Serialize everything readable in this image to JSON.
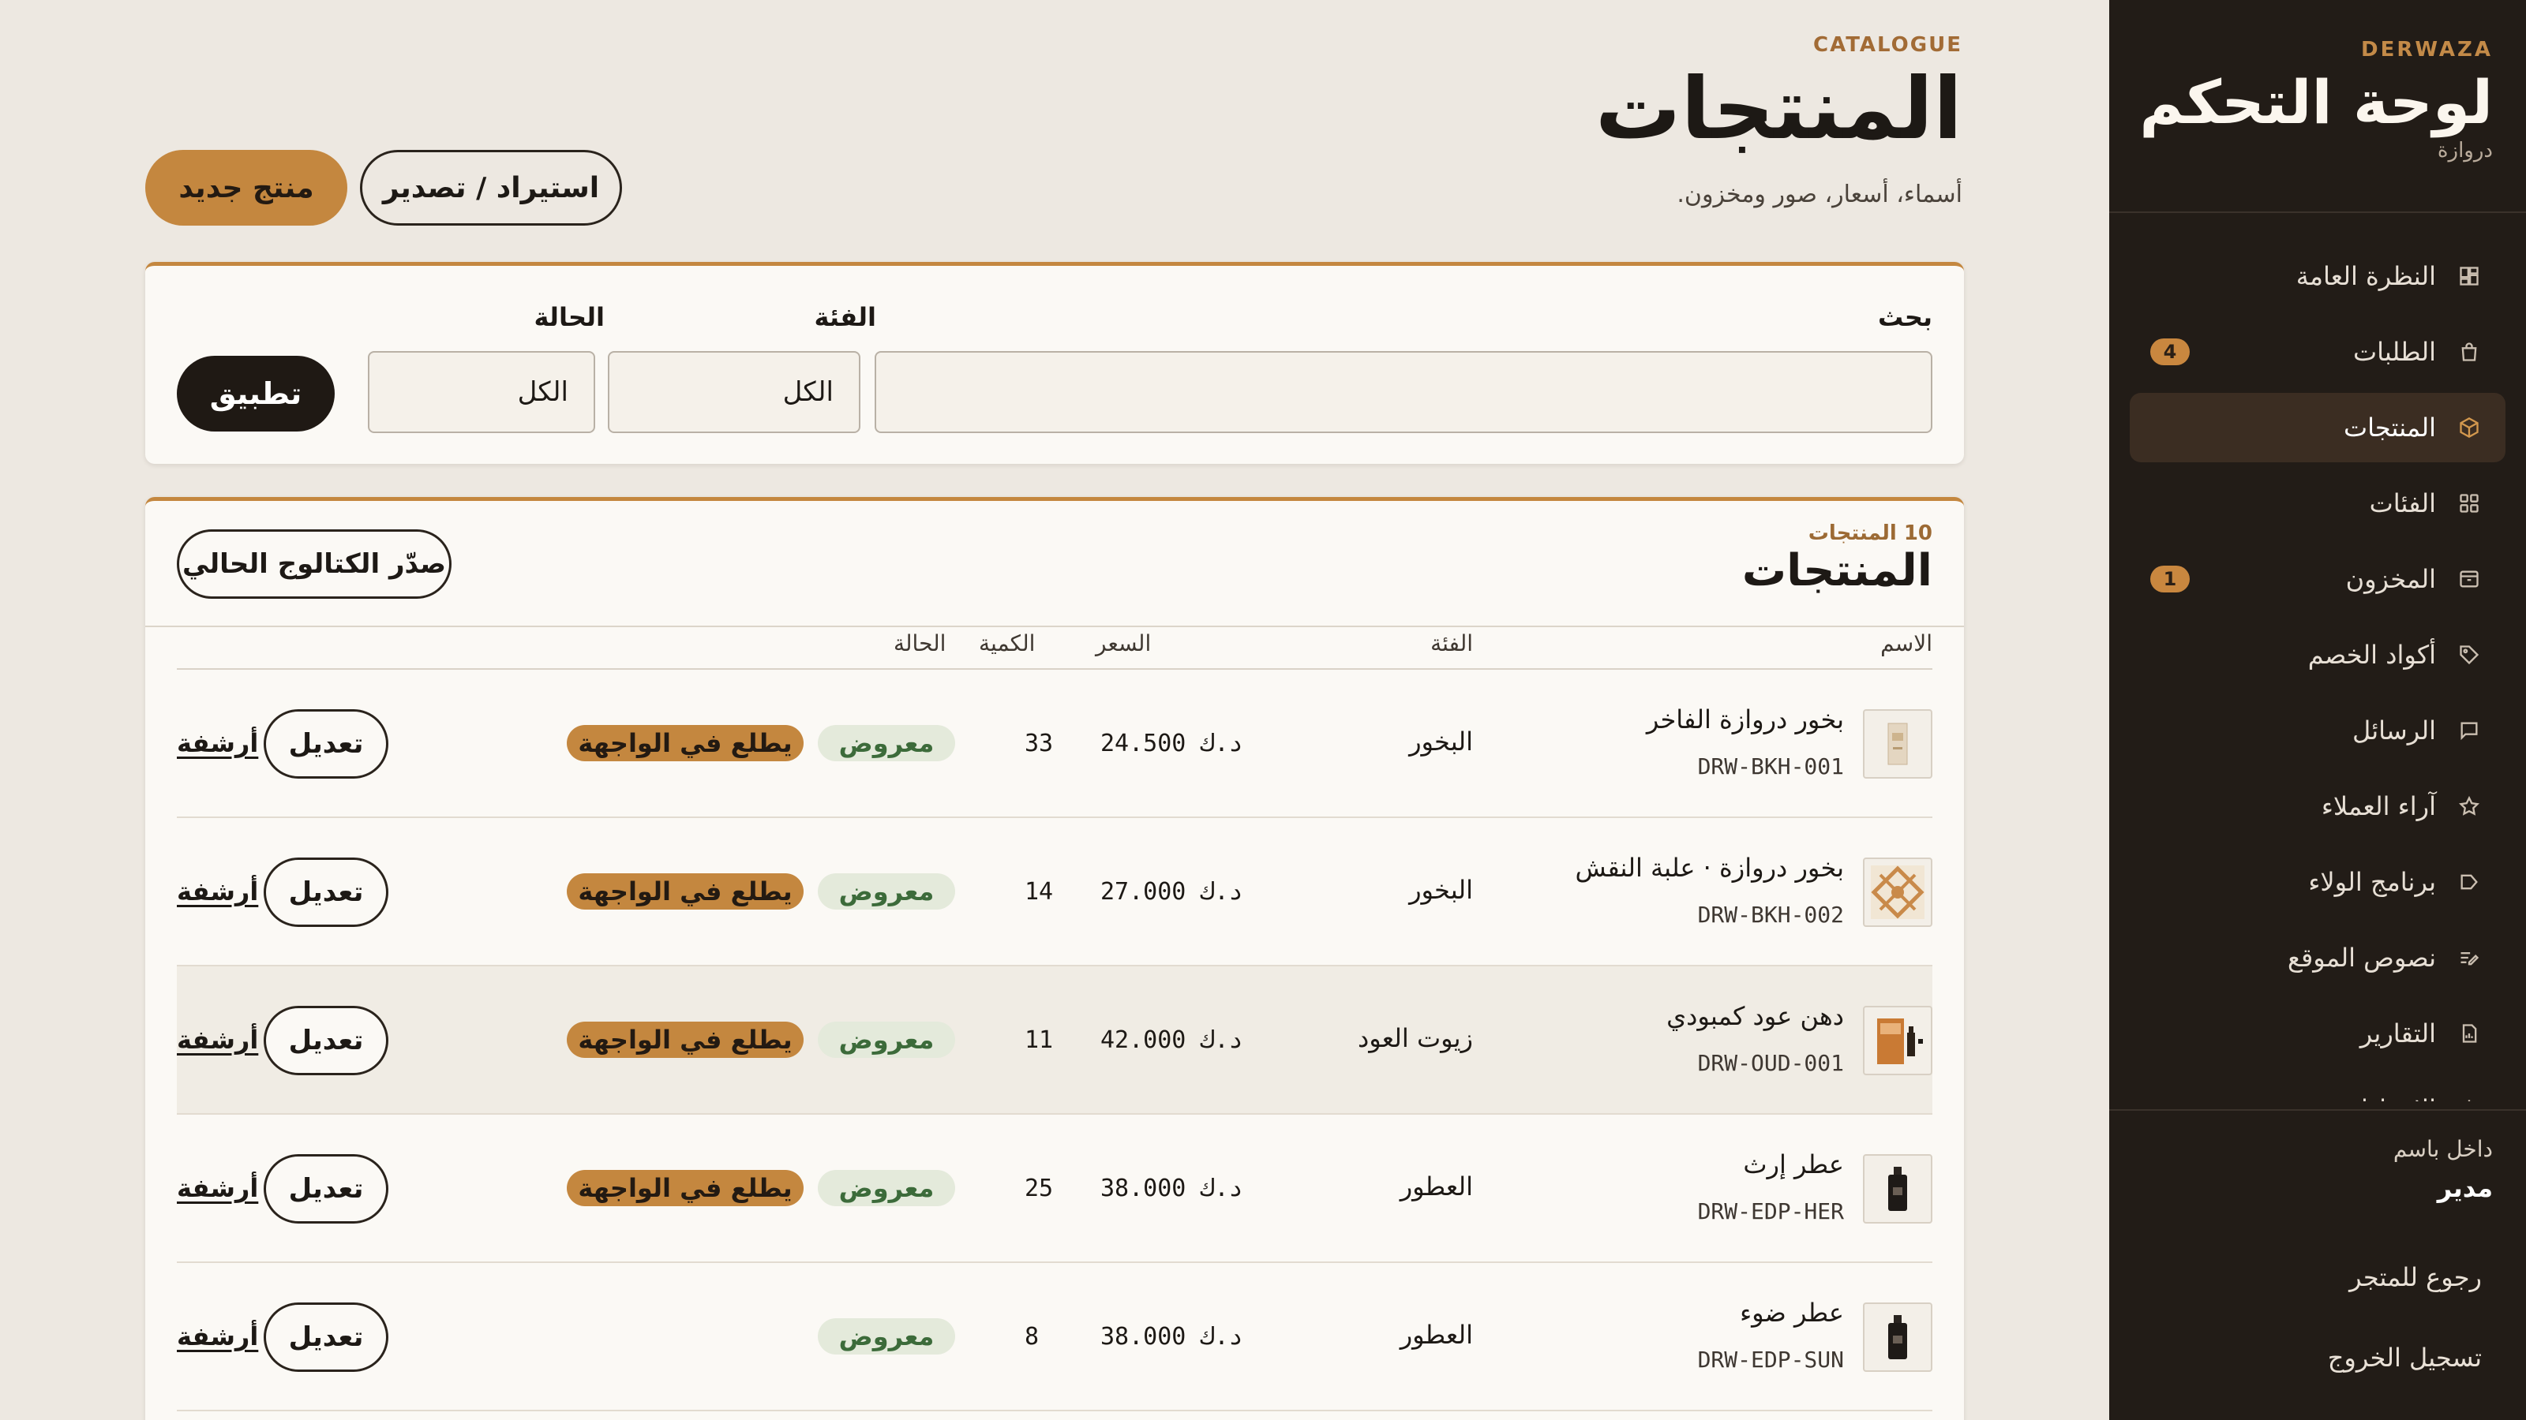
{
  "sidebar": {
    "brand_eyebrow": "DERWAZA",
    "brand_title": "لوحة التحكم",
    "brand_sub": "دروازة",
    "items": [
      {
        "label": "النظرة العامة",
        "icon": "dashboard-icon",
        "badge": ""
      },
      {
        "label": "الطلبات",
        "icon": "shopping-bag-icon",
        "badge": "4"
      },
      {
        "label": "المنتجات",
        "icon": "box-icon",
        "badge": "",
        "active": true
      },
      {
        "label": "الفئات",
        "icon": "grid-icon",
        "badge": ""
      },
      {
        "label": "المخزون",
        "icon": "archive-icon",
        "badge": "1"
      },
      {
        "label": "أكواد الخصم",
        "icon": "tag-icon",
        "badge": ""
      },
      {
        "label": "الرسائل",
        "icon": "chat-icon",
        "badge": ""
      },
      {
        "label": "آراء العملاء",
        "icon": "star-icon",
        "badge": ""
      },
      {
        "label": "برنامج الولاء",
        "icon": "label-icon",
        "badge": ""
      },
      {
        "label": "نصوص الموقع",
        "icon": "edit-text-icon",
        "badge": ""
      },
      {
        "label": "التقارير",
        "icon": "report-icon",
        "badge": ""
      },
      {
        "label": "الإعدادات",
        "icon": "gear-icon",
        "badge": ""
      }
    ],
    "logged_in_label": "داخل باسم",
    "logged_in_name": "مدير",
    "back_to_store": "رجوع للمتجر",
    "logout": "تسجيل الخروج"
  },
  "header": {
    "eyebrow": "CATALOGUE",
    "title": "المنتجات",
    "subtitle": "أسماء، أسعار، صور ومخزون.",
    "new_product": "منتج جديد",
    "import_export": "استيراد / تصدير"
  },
  "filters": {
    "search_label": "بحث",
    "search_value": "",
    "category_label": "الفئة",
    "category_value": "الكل",
    "status_label": "الحالة",
    "status_value": "الكل",
    "apply": "تطبيق"
  },
  "products": {
    "count_label": "10 المنتجات",
    "title": "المنتجات",
    "export_catalog": "صدّر الكتالوج الحالي",
    "columns": {
      "name": "الاسم",
      "category": "الفئة",
      "price": "السعر",
      "quantity": "الكمية",
      "status": "الحالة"
    },
    "rows": [
      {
        "name": "بخور دروازة الفاخر",
        "sku": "DRW-BKH-001",
        "category": "البخور",
        "price": "24.500 د.ك",
        "qty": "33",
        "status": "معروض",
        "featured": "يطلع في الواجهة",
        "edit": "تعديل",
        "archive": "أرشفة",
        "thumb": "incense-box"
      },
      {
        "name": "بخور دروازة · علبة النقش",
        "sku": "DRW-BKH-002",
        "category": "البخور",
        "price": "27.000 د.ك",
        "qty": "14",
        "status": "معروض",
        "featured": "يطلع في الواجهة",
        "edit": "تعديل",
        "archive": "أرشفة",
        "thumb": "pattern-box"
      },
      {
        "name": "دهن عود كمبودي",
        "sku": "DRW-OUD-001",
        "category": "زيوت العود",
        "price": "42.000 د.ك",
        "qty": "11",
        "status": "معروض",
        "featured": "يطلع في الواجهة",
        "edit": "تعديل",
        "archive": "أرشفة",
        "thumb": "oud-bottle"
      },
      {
        "name": "عطر إرث",
        "sku": "DRW-EDP-HER",
        "category": "العطور",
        "price": "38.000 د.ك",
        "qty": "25",
        "status": "معروض",
        "featured": "يطلع في الواجهة",
        "edit": "تعديل",
        "archive": "أرشفة",
        "thumb": "perfume-bottle"
      },
      {
        "name": "عطر ضوء",
        "sku": "DRW-EDP-SUN",
        "category": "العطور",
        "price": "38.000 د.ك",
        "qty": "8",
        "status": "معروض",
        "featured": "",
        "edit": "تعديل",
        "archive": "أرشفة",
        "thumb": "perfume-bottle"
      }
    ]
  },
  "colors": {
    "accent": "#c4873f",
    "sidebar_bg": "#221c17",
    "page_bg": "#ede8e1",
    "status_green": "#3c6b3a"
  }
}
